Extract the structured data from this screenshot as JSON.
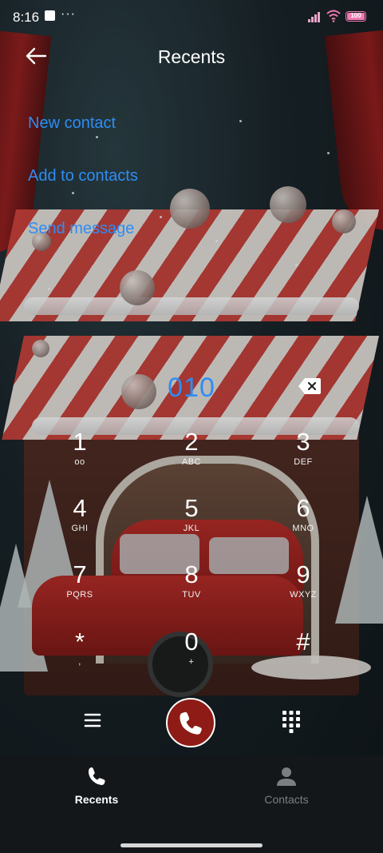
{
  "status_bar": {
    "time": "8:16",
    "dots": "···",
    "battery_level": "100",
    "accent_color": "#f07ab0"
  },
  "header": {
    "title": "Recents",
    "back_icon": "arrow-left-icon"
  },
  "actions": [
    {
      "label": "New contact"
    },
    {
      "label": "Add to contacts"
    },
    {
      "label": "Send message"
    }
  ],
  "dialer": {
    "number": "010",
    "backspace_icon": "backspace-icon",
    "keys": [
      {
        "digit": "1",
        "letters": "oo"
      },
      {
        "digit": "2",
        "letters": "ABC"
      },
      {
        "digit": "3",
        "letters": "DEF"
      },
      {
        "digit": "4",
        "letters": "GHI"
      },
      {
        "digit": "5",
        "letters": "JKL"
      },
      {
        "digit": "6",
        "letters": "MNO"
      },
      {
        "digit": "7",
        "letters": "PQRS"
      },
      {
        "digit": "8",
        "letters": "TUV"
      },
      {
        "digit": "9",
        "letters": "WXYZ"
      },
      {
        "digit": "*",
        "letters": ","
      },
      {
        "digit": "0",
        "letters": "+"
      },
      {
        "digit": "#",
        "letters": ""
      }
    ],
    "menu_icon": "menu-icon",
    "call_icon": "phone-icon",
    "keypad_icon": "dialpad-icon",
    "call_button_color": "#8e1b15",
    "number_color": "#2e8df5"
  },
  "tabs": [
    {
      "label": "Recents",
      "icon": "phone-icon",
      "active": true
    },
    {
      "label": "Contacts",
      "icon": "person-icon",
      "active": false
    }
  ]
}
